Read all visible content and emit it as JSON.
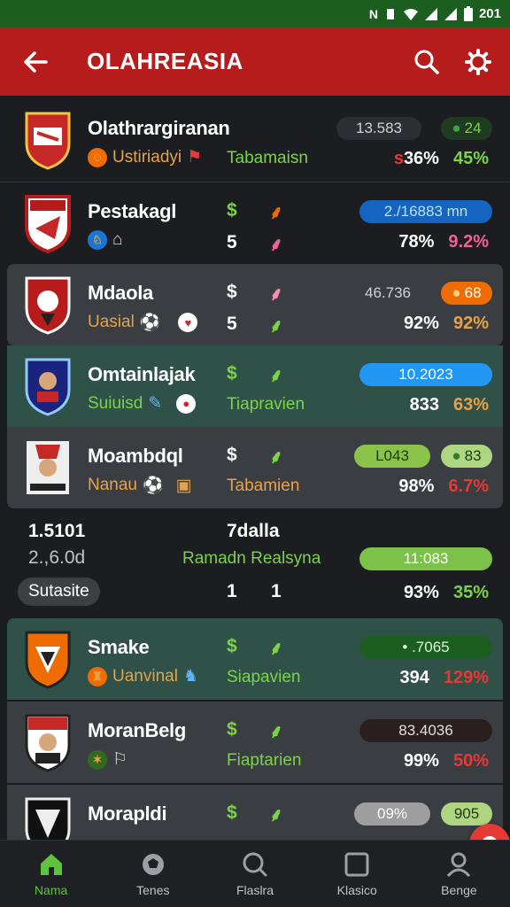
{
  "status_bar": {
    "time": "201",
    "icons": [
      "nfc-icon",
      "vibrate-icon",
      "wifi-icon",
      "signal-icon",
      "signal-icon",
      "battery-icon"
    ]
  },
  "app_bar": {
    "title": "OLAHREASIA",
    "back_icon": "arrow-left-icon",
    "search_icon": "search-icon",
    "settings_icon": "gear-icon"
  },
  "teams": [
    {
      "name": "Olathrargiranan",
      "sub": "Ustiriadyi",
      "mid_top": "",
      "mid_bottom": "Tabamaisn",
      "pill": "13.583",
      "pill_badge": "24",
      "pct1": "36%",
      "pct1_prefix": "s",
      "pct2": "45%",
      "pct1_color": "#ffffff",
      "pct2_color": "#7cd34a",
      "pill_color": "#2b2f33",
      "pill_text_color": "#cfd3d6",
      "badge_color": "#2e7d32"
    },
    {
      "name": "Pestakagl",
      "sub": "",
      "mid_top": "$",
      "mid_top2": "5",
      "mid_bottom": "",
      "pill": "2./16883 mn",
      "pct1": "78%",
      "pct2": "9.2%",
      "pct1_color": "#ffffff",
      "pct2_color": "#f06292",
      "pill_color": "#1565c0",
      "pill_text_color": "#bde0ff"
    },
    {
      "name": "Mdaola",
      "sub": "Uasial",
      "mid_top": "$",
      "mid_top2": "5",
      "mid_bottom": "",
      "pill": "46.736",
      "pill_badge": "68",
      "pct1": "92%",
      "pct2": "92%",
      "pct1_color": "#ffffff",
      "pct2_color": "#e6a24a",
      "pill_color": "#3a3e42",
      "pill_text_color": "#cfd3d6",
      "badge_color": "#ef6c00"
    },
    {
      "name": "Omtainlajak",
      "sub": "Suiuisd",
      "mid_top": "$",
      "mid_bottom": "Tiapravien",
      "pill": "10.2023",
      "pct1": "833",
      "pct2": "63%",
      "pct1_color": "#ffffff",
      "pct2_color": "#e6a24a",
      "pill_color": "#2196f3",
      "pill_text_color": "#ffffff"
    },
    {
      "name": "Moambdql",
      "sub": "Nanau",
      "mid_top": "$",
      "mid_bottom": "Tabamien",
      "pill": "L043",
      "pill_badge": "83",
      "pct1": "98%",
      "pct2": "6.7%",
      "pct1_color": "#ffffff",
      "pct2_color": "#e53935",
      "pill_color": "#8bc34a",
      "pill_text_color": "#1b3a0c",
      "badge_color": "#558b2f"
    }
  ],
  "summary": {
    "left_top": "1.5101",
    "left_mid": "2.,6.0d",
    "chip": "Sutasite",
    "center_top": "7dalla",
    "center_mid": "Ramadn Realsyna",
    "num1": "1",
    "num2": "1",
    "pill": "11:083",
    "pct1": "93%",
    "pct2": "35%"
  },
  "teams2": [
    {
      "name": "Smake",
      "sub": "Uanvinal",
      "mid_top": "$",
      "mid_bottom": "Siapavien",
      "pill": "• .7065",
      "pct1": "394",
      "pct2": "129%",
      "pct1_color": "#ffffff",
      "pct2_color": "#e53935",
      "pill_color": "#1b5e20",
      "pill_text_color": "#dff5d5"
    },
    {
      "name": "MoranBelg",
      "sub": "",
      "mid_top": "$",
      "mid_bottom": "Fiaptarien",
      "pill": "83.4036",
      "pct1": "99%",
      "pct2": "50%",
      "pct1_color": "#ffffff",
      "pct2_color": "#e53935",
      "pill_color": "#2a1f1f",
      "pill_text_color": "#e0e0e0"
    },
    {
      "name": "Morapldi",
      "sub": "",
      "mid_top": "$",
      "mid_bottom": "",
      "pill": "09%",
      "pill_badge": "905",
      "pct1": "",
      "pct2": "",
      "pct1_color": "#ffffff",
      "pct2_color": "#ffffff",
      "pill_color": "#9e9e9e",
      "pill_text_color": "#ffffff",
      "badge_color": "#8bc34a"
    }
  ],
  "nav": [
    {
      "label": "Nama",
      "icon": "home-icon",
      "active": true
    },
    {
      "label": "Tenes",
      "icon": "ball-icon",
      "active": false
    },
    {
      "label": "Flaslra",
      "icon": "search-icon",
      "active": false
    },
    {
      "label": "Klasico",
      "icon": "square-icon",
      "active": false
    },
    {
      "label": "Benge",
      "icon": "profile-icon",
      "active": false
    }
  ],
  "fab_icon": "sparkle-icon",
  "colors": {
    "accent_red": "#b71c1c",
    "accent_green": "#5fc43d",
    "status_green": "#1b5e20"
  }
}
